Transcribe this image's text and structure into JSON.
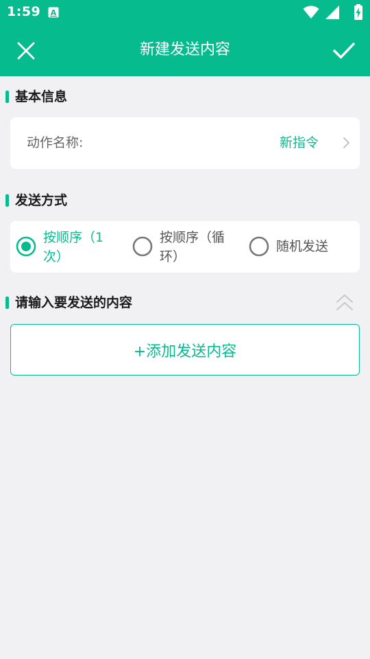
{
  "status_bar": {
    "time": "1:59",
    "icons": [
      "a-notification-icon",
      "wifi-icon",
      "cellular-signal-icon",
      "battery-charging-icon"
    ]
  },
  "app_bar": {
    "title": "新建发送内容",
    "left_icon": "close-icon",
    "right_icon": "check-icon"
  },
  "basic_info": {
    "section_title": "基本信息",
    "name_label": "动作名称:",
    "name_value": "新指令"
  },
  "send_mode": {
    "section_title": "发送方式",
    "options": [
      {
        "label": "按顺序（1次）",
        "checked": true
      },
      {
        "label": "按顺序（循环）",
        "checked": false
      },
      {
        "label": "随机发送",
        "checked": false
      }
    ]
  },
  "content": {
    "section_title": "请输入要发送的内容",
    "add_label": "+添加发送内容"
  },
  "colors": {
    "primary": "#06BC8E",
    "background": "#F1F1F3",
    "card": "#FFFFFF",
    "muted_text": "#666666"
  }
}
